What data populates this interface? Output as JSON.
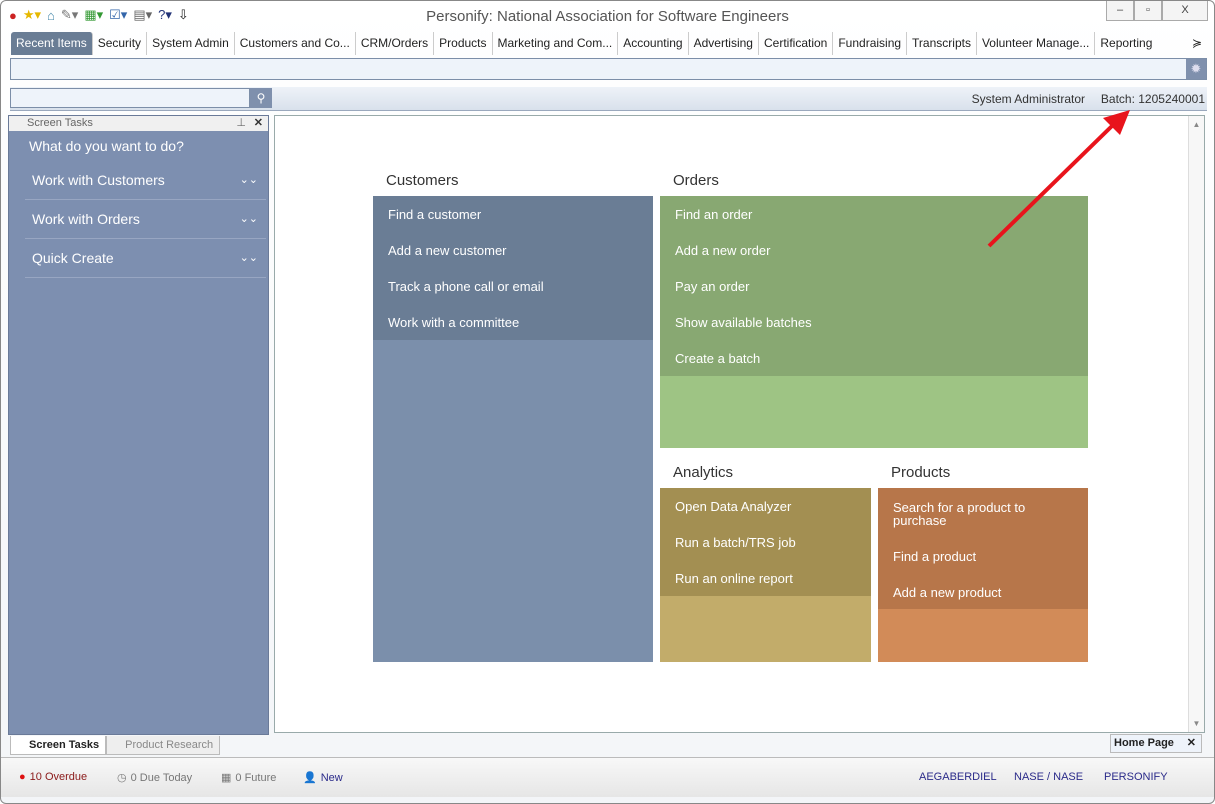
{
  "window": {
    "title": "Personify: National Association for Software Engineers",
    "minimize": "–",
    "restore": "▫",
    "close": "X"
  },
  "ribbon_tabs": [
    {
      "label": "Recent Items",
      "active": true
    },
    {
      "label": "Security"
    },
    {
      "label": "System Admin"
    },
    {
      "label": "Customers and Co..."
    },
    {
      "label": "CRM/Orders"
    },
    {
      "label": "Products"
    },
    {
      "label": "Marketing and Com..."
    },
    {
      "label": "Accounting"
    },
    {
      "label": "Advertising"
    },
    {
      "label": "Certification"
    },
    {
      "label": "Fundraising"
    },
    {
      "label": "Transcripts"
    },
    {
      "label": "Volunteer Manage..."
    },
    {
      "label": "Reporting"
    }
  ],
  "ribbon_more": "≽",
  "search": {
    "value": "",
    "placeholder": ""
  },
  "header": {
    "user": "System Administrator",
    "batch": "Batch: 1205240001"
  },
  "sidebar": {
    "title": "Screen Tasks",
    "prompt": "What do you want to do?",
    "items": [
      {
        "label": "Work with Customers"
      },
      {
        "label": "Work with Orders"
      },
      {
        "label": "Quick Create"
      }
    ],
    "bottom_tabs": [
      {
        "label": "Screen Tasks",
        "active": true
      },
      {
        "label": "Product Research"
      }
    ]
  },
  "home": {
    "tab": "Home Page",
    "sections": {
      "customers": {
        "title": "Customers",
        "color": "#6a7d95",
        "links": [
          "Find a customer",
          "Add a new customer",
          "Track a phone call or email",
          "Work with a committee"
        ]
      },
      "orders": {
        "title": "Orders",
        "color": "#86a670",
        "links": [
          "Find an order",
          "Add a new order",
          "Pay an order",
          "Show available batches",
          "Create a batch"
        ]
      },
      "analytics": {
        "title": "Analytics",
        "color": "#a08d52",
        "links": [
          "Open Data Analyzer",
          "Run a batch/TRS job",
          "Run an online report"
        ]
      },
      "products": {
        "title": "Products",
        "color": "#b5754a",
        "links": [
          "Search for a product to purchase",
          "Find a product",
          "Add a new product"
        ]
      }
    }
  },
  "status": {
    "overdue": "10 Overdue",
    "due_today": "0 Due Today",
    "future": "0 Future",
    "new": "New",
    "user": "AEGABERDIEL",
    "org": "NASE / NASE",
    "app": "PERSONIFY"
  },
  "annotation": {
    "color": "#e8141c"
  }
}
